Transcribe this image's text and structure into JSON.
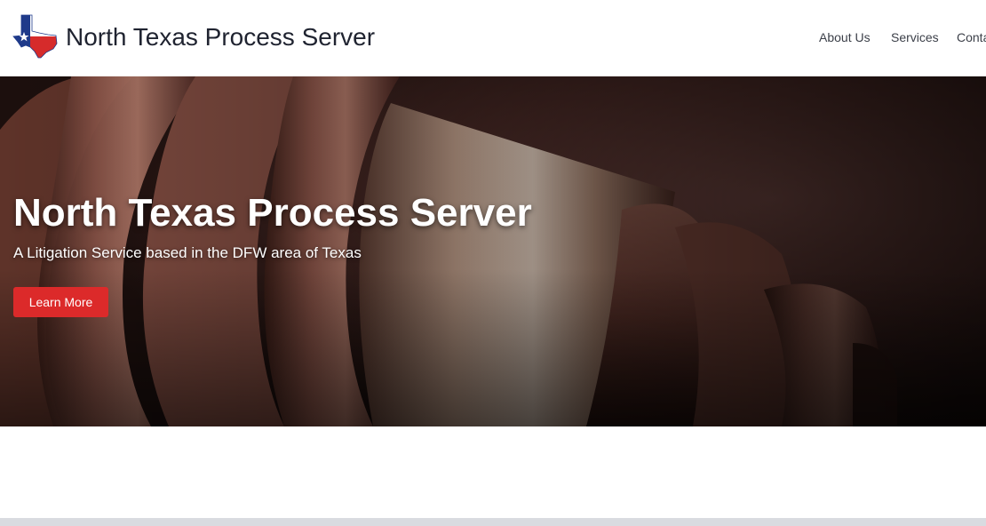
{
  "header": {
    "site_title": "North Texas Process Server",
    "logo_icon": "texas-flag-map-icon"
  },
  "nav": {
    "items": [
      {
        "label": "About Us"
      },
      {
        "label": "Services"
      },
      {
        "label": "Conta"
      }
    ]
  },
  "hero": {
    "title": "North Texas Process Server",
    "subtitle": "A Litigation Service based in the DFW area of Texas",
    "cta_label": "Learn More",
    "background_image": "wooden-gavel-photo"
  },
  "colors": {
    "cta_background": "#dc2a2a",
    "title_text": "#1f2330",
    "nav_text": "#3b3f48"
  }
}
